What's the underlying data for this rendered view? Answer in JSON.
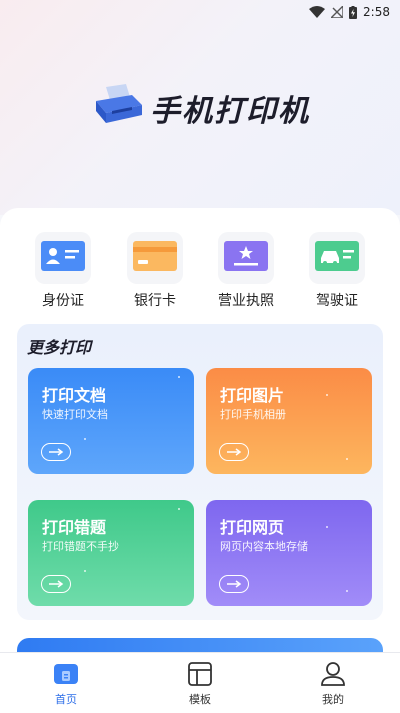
{
  "status_bar": {
    "time": "2:58"
  },
  "app": {
    "title": "手机打印机"
  },
  "quick_actions": [
    {
      "label": "身份证",
      "icon": "id-card-icon"
    },
    {
      "label": "银行卡",
      "icon": "bank-card-icon"
    },
    {
      "label": "营业执照",
      "icon": "business-license-icon"
    },
    {
      "label": "驾驶证",
      "icon": "driver-license-icon"
    }
  ],
  "more_print": {
    "title": "更多打印",
    "cards": [
      {
        "title": "打印文档",
        "subtitle": "快速打印文档"
      },
      {
        "title": "打印图片",
        "subtitle": "打印手机相册"
      },
      {
        "title": "打印错题",
        "subtitle": "打印错题不手抄"
      },
      {
        "title": "打印网页",
        "subtitle": "网页内容本地存储"
      }
    ]
  },
  "tabs": [
    {
      "label": "首页",
      "icon": "home-icon",
      "active": true
    },
    {
      "label": "模板",
      "icon": "template-icon",
      "active": false
    },
    {
      "label": "我的",
      "icon": "profile-icon",
      "active": false
    }
  ],
  "colors": {
    "accent": "#2f6fe8",
    "card_blue": "#3a8bf7",
    "card_orange": "#fb8c46",
    "card_green": "#3fc98a",
    "card_purple": "#7e67ef"
  }
}
